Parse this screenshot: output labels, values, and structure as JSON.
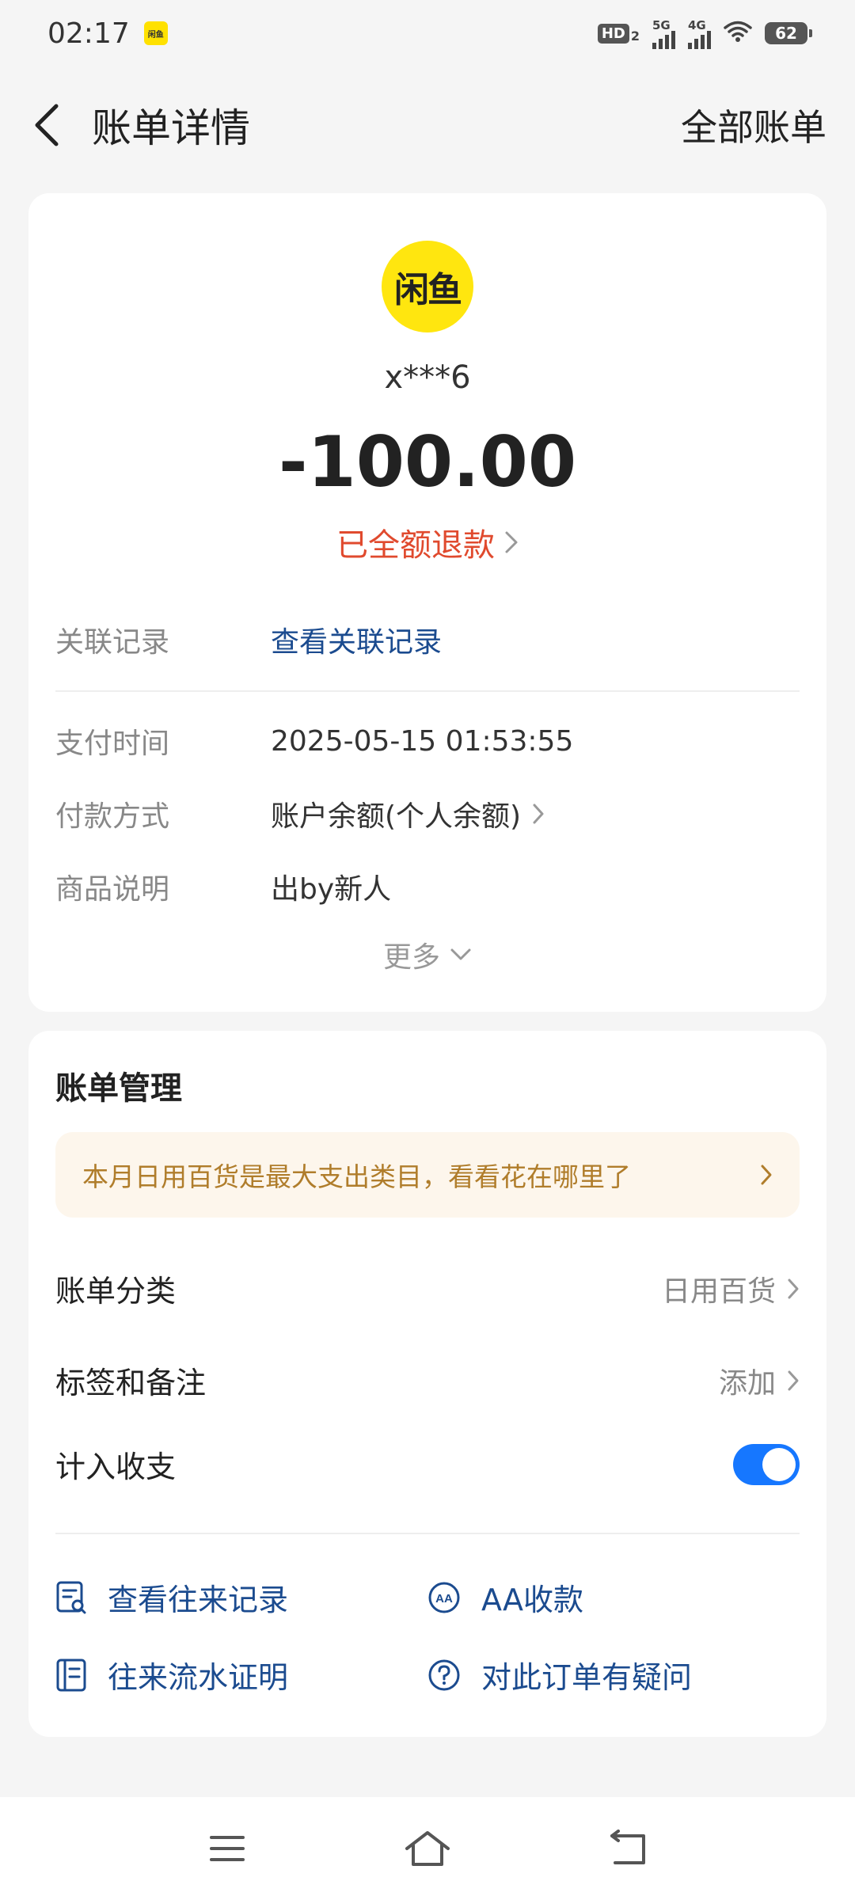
{
  "status_bar": {
    "time": "02:17",
    "app_icon_text": "闲鱼",
    "hd": "HD",
    "hd_sub": "2",
    "signal1": "5G",
    "signal2": "4G",
    "battery": "62"
  },
  "header": {
    "title": "账单详情",
    "all_bills": "全部账单"
  },
  "bill": {
    "merchant_logo_text": "闲鱼",
    "merchant_name": "x***6",
    "amount": "-100.00",
    "status": "已全额退款",
    "related_label": "关联记录",
    "related_value": "查看关联记录",
    "pay_time_label": "支付时间",
    "pay_time_value": "2025-05-15 01:53:55",
    "pay_method_label": "付款方式",
    "pay_method_value": "账户余额(个人余额)",
    "goods_label": "商品说明",
    "goods_value": "出by新人",
    "more": "更多"
  },
  "manage": {
    "title": "账单管理",
    "tip": "本月日用百货是最大支出类目，看看花在哪里了",
    "category_label": "账单分类",
    "category_value": "日用百货",
    "tags_label": "标签和备注",
    "tags_value": "添加",
    "count_label": "计入收支",
    "count_enabled": true,
    "actions": {
      "history": "查看往来记录",
      "aa": "AA收款",
      "proof": "往来流水证明",
      "question": "对此订单有疑问"
    }
  },
  "colors": {
    "accent": "#1677ff",
    "link": "#1b4b8f",
    "refund": "#e04a2e",
    "brand_yellow": "#ffe60f",
    "tip_text": "#b07d2b"
  }
}
